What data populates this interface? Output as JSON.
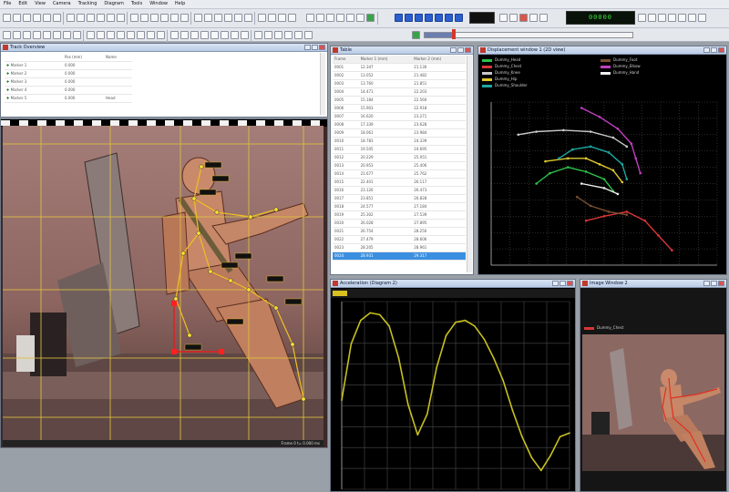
{
  "menu": [
    "File",
    "Edit",
    "View",
    "Camera",
    "Tracking",
    "Diagram",
    "Tools",
    "Window",
    "Help"
  ],
  "toolbar": {
    "readout": "00000"
  },
  "tracker_window": {
    "title": "Track Overview",
    "headers": [
      "",
      "Pos (mm)",
      "Name"
    ],
    "rows": [
      {
        "label": "Marker 1",
        "value": "0.000",
        "name": ""
      },
      {
        "label": "Marker 2",
        "value": "0.000",
        "name": ""
      },
      {
        "label": "Marker 3",
        "value": "0.000",
        "name": ""
      },
      {
        "label": "Marker 4",
        "value": "0.000",
        "name": ""
      },
      {
        "label": "Marker 5",
        "value": "0.000",
        "name": "Head"
      }
    ]
  },
  "table_window": {
    "title": "Table",
    "headers": [
      "Frame",
      "Marker 1 (mm)",
      "Marker 2 (mm)"
    ],
    "rows": [
      [
        "0001",
        "12.347",
        "21.130"
      ],
      [
        "0002",
        "13.052",
        "21.482"
      ],
      [
        "0003",
        "13.760",
        "21.851"
      ],
      [
        "0004",
        "14.471",
        "22.203"
      ],
      [
        "0005",
        "15.184",
        "22.560"
      ],
      [
        "0006",
        "15.903",
        "22.918"
      ],
      [
        "0007",
        "16.620",
        "23.271"
      ],
      [
        "0008",
        "17.339",
        "23.628"
      ],
      [
        "0009",
        "18.061",
        "23.984"
      ],
      [
        "0010",
        "18.783",
        "24.339"
      ],
      [
        "0011",
        "19.505",
        "24.695"
      ],
      [
        "0012",
        "20.229",
        "25.051"
      ],
      [
        "0013",
        "20.953",
        "25.406"
      ],
      [
        "0014",
        "21.677",
        "25.762"
      ],
      [
        "0015",
        "22.401",
        "26.117"
      ],
      [
        "0016",
        "23.126",
        "26.473"
      ],
      [
        "0017",
        "23.851",
        "26.828"
      ],
      [
        "0018",
        "24.577",
        "27.184"
      ],
      [
        "0019",
        "25.302",
        "27.539"
      ],
      [
        "0020",
        "26.028",
        "27.895"
      ],
      [
        "0021",
        "26.754",
        "28.250"
      ],
      [
        "0022",
        "27.479",
        "28.606"
      ],
      [
        "0023",
        "28.205",
        "28.961"
      ],
      [
        "0024",
        "28.931",
        "29.317"
      ]
    ]
  },
  "trajectory_window": {
    "title": "Displacement window 1 (2D view)",
    "legend": [
      {
        "name": "Dummy_Head",
        "color": "#2cc24a"
      },
      {
        "name": "Dummy_Chest",
        "color": "#d93636"
      },
      {
        "name": "Dummy_Knee",
        "color": "#c9c9c9"
      },
      {
        "name": "Dummy_Hip",
        "color": "#e0c830"
      },
      {
        "name": "Dummy_Shoulder",
        "color": "#1aa8a0"
      },
      {
        "name": "Dummy_Foot",
        "color": "#7a5030"
      },
      {
        "name": "Dummy_Elbow",
        "color": "#c040c0"
      },
      {
        "name": "Dummy_Hand",
        "color": "#f0f0f0"
      }
    ]
  },
  "signal_window": {
    "title": "Acceleration (Diagram 2)"
  },
  "thumb_window": {
    "title": "Image Window 2"
  },
  "status": {
    "cam": "Frame 0  t= 0.000 ms"
  },
  "colors": {
    "accent": "#2b5fd0",
    "trajectory_bg": "#000000",
    "signal_line": "#c8c020",
    "grid": "#e0c040"
  },
  "chart_data": [
    {
      "type": "line",
      "series": [
        {
          "name": "Dummy_Head",
          "color": "#2cc24a",
          "points": [
            [
              0.2,
              0.55
            ],
            [
              0.26,
              0.62
            ],
            [
              0.34,
              0.66
            ],
            [
              0.42,
              0.63
            ],
            [
              0.5,
              0.58
            ],
            [
              0.54,
              0.5
            ]
          ]
        },
        {
          "name": "Dummy_Chest",
          "color": "#d93636",
          "points": [
            [
              0.42,
              0.3
            ],
            [
              0.5,
              0.33
            ],
            [
              0.6,
              0.36
            ],
            [
              0.68,
              0.3
            ],
            [
              0.74,
              0.2
            ],
            [
              0.8,
              0.1
            ]
          ]
        },
        {
          "name": "Dummy_Knee",
          "color": "#c9c9c9",
          "points": [
            [
              0.12,
              0.88
            ],
            [
              0.2,
              0.9
            ],
            [
              0.32,
              0.91
            ],
            [
              0.44,
              0.9
            ],
            [
              0.54,
              0.86
            ],
            [
              0.6,
              0.8
            ]
          ]
        },
        {
          "name": "Dummy_Hip",
          "color": "#e0c830",
          "points": [
            [
              0.24,
              0.7
            ],
            [
              0.34,
              0.72
            ],
            [
              0.42,
              0.72
            ],
            [
              0.48,
              0.68
            ],
            [
              0.54,
              0.64
            ],
            [
              0.58,
              0.56
            ]
          ]
        },
        {
          "name": "Dummy_Shoulder",
          "color": "#1aa8a0",
          "points": [
            [
              0.3,
              0.72
            ],
            [
              0.36,
              0.78
            ],
            [
              0.44,
              0.8
            ],
            [
              0.52,
              0.76
            ],
            [
              0.58,
              0.68
            ],
            [
              0.6,
              0.58
            ]
          ]
        },
        {
          "name": "Dummy_Elbow",
          "color": "#c040c0",
          "points": [
            [
              0.4,
              1.06
            ],
            [
              0.48,
              1.0
            ],
            [
              0.56,
              0.92
            ],
            [
              0.62,
              0.82
            ],
            [
              0.64,
              0.72
            ],
            [
              0.66,
              0.62
            ]
          ]
        },
        {
          "name": "Dummy_Foot",
          "color": "#7a5030",
          "points": [
            [
              0.38,
              0.46
            ],
            [
              0.44,
              0.4
            ],
            [
              0.52,
              0.36
            ],
            [
              0.6,
              0.34
            ]
          ]
        },
        {
          "name": "Dummy_Hand",
          "color": "#f0f0f0",
          "points": [
            [
              0.4,
              0.55
            ],
            [
              0.5,
              0.52
            ],
            [
              0.56,
              0.48
            ]
          ]
        }
      ]
    },
    {
      "type": "line",
      "series": [
        {
          "name": "",
          "values": [
            -0.05,
            0.55,
            0.8,
            0.88,
            0.86,
            0.74,
            0.4,
            -0.1,
            -0.42,
            -0.2,
            0.3,
            0.64,
            0.78,
            0.8,
            0.74,
            0.6,
            0.4,
            0.16,
            -0.16,
            -0.44,
            -0.66,
            -0.8,
            -0.64,
            -0.44,
            -0.4
          ]
        }
      ]
    }
  ]
}
